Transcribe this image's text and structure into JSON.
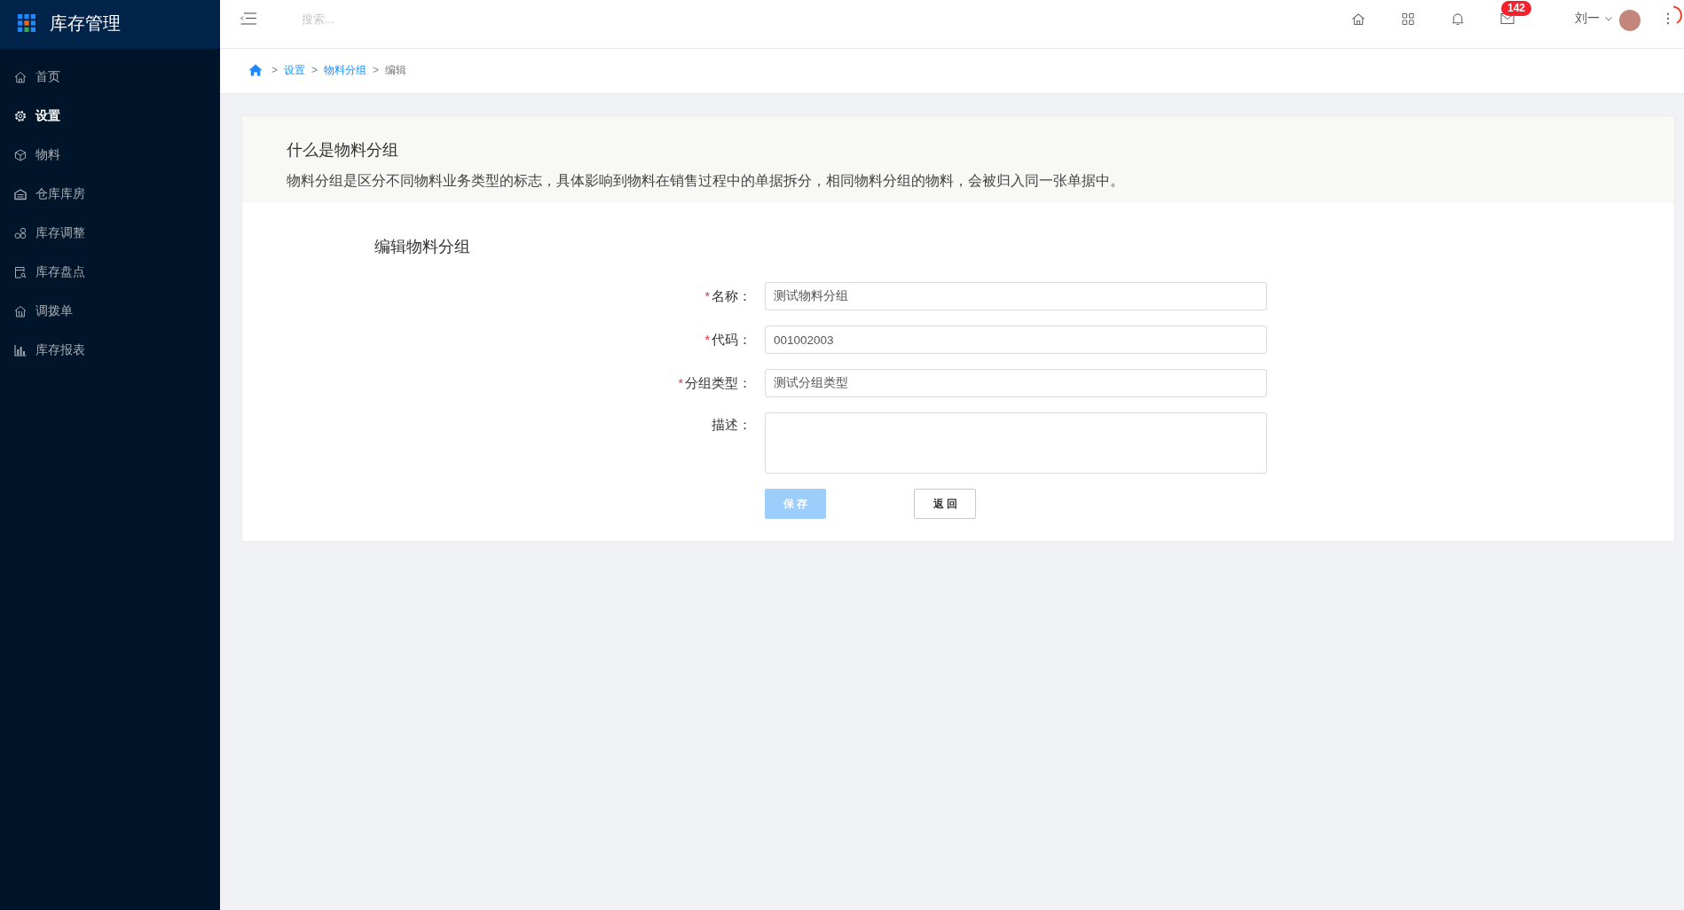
{
  "sidebar": {
    "title": "库存管理",
    "items": [
      {
        "label": "首页",
        "selected": false
      },
      {
        "label": "设置",
        "selected": true
      },
      {
        "label": "物料",
        "selected": false
      },
      {
        "label": "仓库库房",
        "selected": false
      },
      {
        "label": "库存调整",
        "selected": false
      },
      {
        "label": "库存盘点",
        "selected": false
      },
      {
        "label": "调拨单",
        "selected": false
      },
      {
        "label": "库存报表",
        "selected": false
      }
    ]
  },
  "top_bar": {
    "search": {
      "placeholder": "搜索..."
    },
    "mail_badge": "142",
    "user_name": "刘一"
  },
  "breadcrumb": [
    {
      "separator": ">",
      "label": "设置",
      "kind": "link"
    },
    {
      "separator": ">",
      "label": "物料分组",
      "kind": "link"
    },
    {
      "separator": ">",
      "label": "编辑",
      "kind": "current"
    }
  ],
  "info": {
    "title": "什么是物料分组",
    "description": "物料分组是区分不同物料业务类型的标志，具体影响到物料在销售过程中的单据拆分，相同物料分组的物料，会被归入同一张单据中。"
  },
  "form": {
    "title": "编辑物料分组",
    "fields": [
      {
        "mark": "*",
        "label": "名称：",
        "kind": "input",
        "value": "测试物料分组"
      },
      {
        "mark": "*",
        "label": "代码：",
        "kind": "input",
        "value": "001002003"
      },
      {
        "mark": "*",
        "label": "分组类型：",
        "kind": "input",
        "value": "测试分组类型"
      },
      {
        "label": "描述：",
        "kind": "textarea"
      }
    ],
    "buttons": [
      {
        "label": "保存",
        "kind": "primary",
        "disabled": true
      },
      {
        "label": "返回",
        "kind": "default",
        "disabled": false
      }
    ]
  }
}
